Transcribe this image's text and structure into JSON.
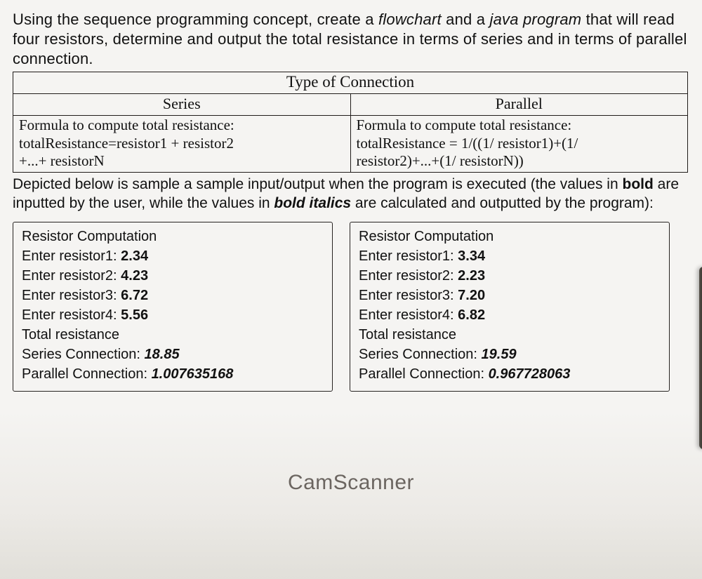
{
  "intro": {
    "t1": "Using the sequence programming concept, create a ",
    "t2": "flowchart",
    "t3": " and a ",
    "t4": "java program",
    "t5": " that will read four resistors, determine and output the total resistance in terms of series and in terms of parallel connection."
  },
  "table": {
    "header": "Type of Connection",
    "series_label": "Series",
    "parallel_label": "Parallel",
    "series_formula_l1": "Formula to compute total resistance:",
    "series_formula_l2": "totalResistance=resistor1 + resistor2",
    "series_formula_l3": "+...+ resistorN",
    "parallel_formula_l1": "Formula to compute total resistance:",
    "parallel_formula_l2": "totalResistance = 1/((1/ resistor1)+(1/",
    "parallel_formula_l3": "resistor2)+...+(1/ resistorN))"
  },
  "mid": {
    "m1": "Depicted below is sample a sample input/output when the program is executed (the values in ",
    "m2": "bold",
    "m3": " are inputted by the user, while the values in ",
    "m4": "bold italics",
    "m5": " are calculated and outputted by the program):"
  },
  "samples": [
    {
      "title": "Resistor Computation",
      "r1_label": "Enter resistor1: ",
      "r1_val": "2.34",
      "r2_label": "Enter resistor2: ",
      "r2_val": "4.23",
      "r3_label": "Enter resistor3: ",
      "r3_val": "6.72",
      "r4_label": "Enter resistor4: ",
      "r4_val": "5.56",
      "total_label": "Total resistance",
      "series_label": "Series Connection: ",
      "series_val": "18.85",
      "parallel_label": "Parallel Connection: ",
      "parallel_val": "1.007635168"
    },
    {
      "title": "Resistor Computation",
      "r1_label": "Enter resistor1: ",
      "r1_val": "3.34",
      "r2_label": "Enter resistor2: ",
      "r2_val": "2.23",
      "r3_label": "Enter resistor3: ",
      "r3_val": "7.20",
      "r4_label": "Enter resistor4: ",
      "r4_val": "6.82",
      "total_label": "Total resistance",
      "series_label": "Series Connection: ",
      "series_val": "19.59",
      "parallel_label": "Parallel Connection: ",
      "parallel_val": "0.967728063"
    }
  ],
  "watermark": "CamScanner"
}
